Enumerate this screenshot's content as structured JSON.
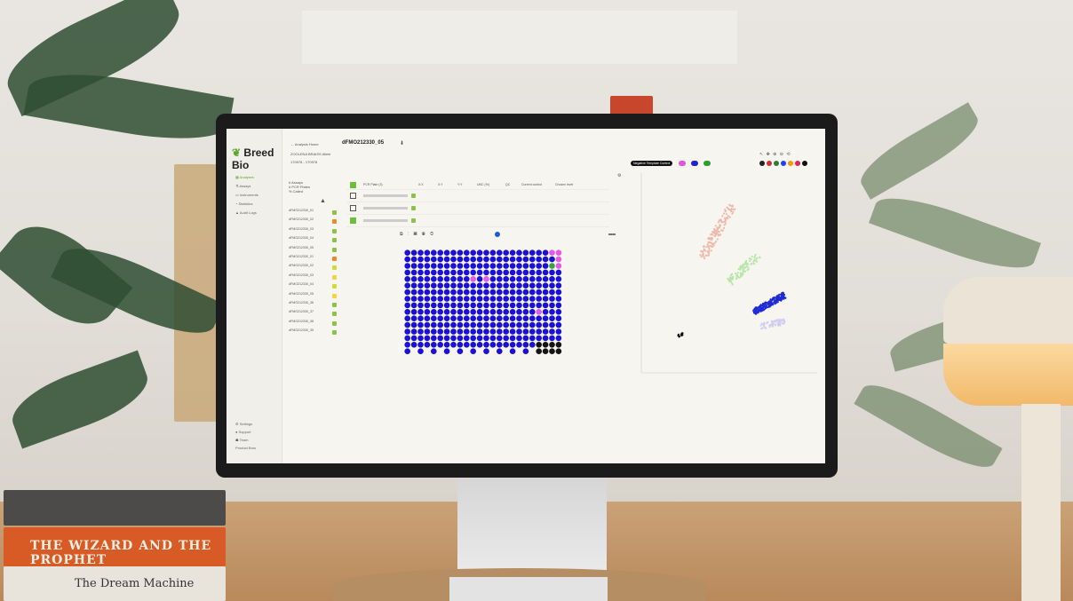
{
  "app": {
    "brand": "Breed Bio",
    "back_link": "← Analysis Home",
    "plate_id": "dFMO212330_05",
    "project": "ZOOLENA BRAISS Allele",
    "run": "170978 - 170978",
    "settings_icon": "gear-icon"
  },
  "sidebar": {
    "items": [
      {
        "label": "Analyses",
        "icon": "grid-icon",
        "active": true
      },
      {
        "label": "Assays",
        "icon": "flask-icon",
        "active": false
      },
      {
        "label": "Instruments",
        "icon": "instrument-icon",
        "active": false
      },
      {
        "label": "Statistics",
        "icon": "chart-icon",
        "active": false
      },
      {
        "label": "Audit Logs",
        "icon": "log-icon",
        "active": false
      }
    ],
    "bottom": [
      {
        "label": "Settings",
        "icon": "gear-icon"
      },
      {
        "label": "Support",
        "icon": "help-icon"
      },
      {
        "label": "Team",
        "icon": "team-icon"
      },
      {
        "label": "Product Bros",
        "icon": "user-icon"
      }
    ]
  },
  "plates_panel": {
    "summary": [
      "# Assays",
      "# PCR Plates",
      "% Called"
    ],
    "plates": [
      {
        "name": "dFMO212330_01",
        "color": "#8bc34a"
      },
      {
        "name": "dFMO212330_02",
        "color": "#f08a24"
      },
      {
        "name": "dFMO212330_03",
        "color": "#8bc34a"
      },
      {
        "name": "dFMO212330_04",
        "color": "#8bc34a"
      },
      {
        "name": "dFMO212330_05",
        "color": "#8bc34a"
      },
      {
        "name": "dFMO212330_01",
        "color": "#f08a24"
      },
      {
        "name": "dFMO212330_02",
        "color": "#cddc39"
      },
      {
        "name": "dFMO212330_03",
        "color": "#f7d046"
      },
      {
        "name": "dFMO212330_04",
        "color": "#cddc39"
      },
      {
        "name": "dFMO212330_05",
        "color": "#f7d046"
      },
      {
        "name": "dFMO212330_36",
        "color": "#8bc34a"
      },
      {
        "name": "dFMO212330_37",
        "color": "#8bc34a"
      },
      {
        "name": "dFMO212330_38",
        "color": "#8bc34a"
      },
      {
        "name": "dFMO212330_39",
        "color": "#8bc34a"
      }
    ]
  },
  "table": {
    "headers": [
      "PCR Plate (3)",
      "X:X",
      "X:Y",
      "Y:Y",
      "UNC (%)",
      "QC",
      "Current control",
      "Chosen level"
    ],
    "rows": [
      {
        "checked": false
      },
      {
        "checked": false
      },
      {
        "checked": true
      }
    ]
  },
  "legend": {
    "label": "Negative Template Control",
    "chips": [
      {
        "color": "#e055e0"
      },
      {
        "color": "#2222cc"
      },
      {
        "color": "#2e9e2e"
      }
    ],
    "palette": [
      "#222222",
      "#d32f2f",
      "#2e7d32",
      "#1e40ff",
      "#ff9800",
      "#e91e63",
      "#111111"
    ]
  },
  "chart_data": {
    "type": "scatter",
    "series": [
      {
        "color": "#f0b8aa",
        "cluster": "upper"
      },
      {
        "color": "#b8e6a8",
        "cluster": "middle"
      },
      {
        "color": "#1f2bd6",
        "cluster": "dense"
      },
      {
        "color": "#d0ccf2",
        "cluster": "lower"
      },
      {
        "color": "#111111",
        "cluster": "ntc"
      }
    ]
  },
  "plate": {
    "rows": 16,
    "cols": 24,
    "base_color": "#1a10d6",
    "special": [
      {
        "r": 0,
        "c": 22,
        "color": "#e55ae5"
      },
      {
        "r": 0,
        "c": 23,
        "color": "#e55ae5"
      },
      {
        "r": 1,
        "c": 23,
        "color": "#e55ae5"
      },
      {
        "r": 2,
        "c": 22,
        "color": "#38a238"
      },
      {
        "r": 2,
        "c": 23,
        "color": "#e55ae5"
      },
      {
        "r": 4,
        "c": 10,
        "color": "#e55ae5"
      },
      {
        "r": 4,
        "c": 12,
        "color": "#e55ae5"
      },
      {
        "r": 9,
        "c": 20,
        "color": "#e55ae5"
      }
    ]
  },
  "books": {
    "middle_title": "THE WIZARD AND THE PROPHET",
    "bottom_title": "The Dream Machine"
  }
}
